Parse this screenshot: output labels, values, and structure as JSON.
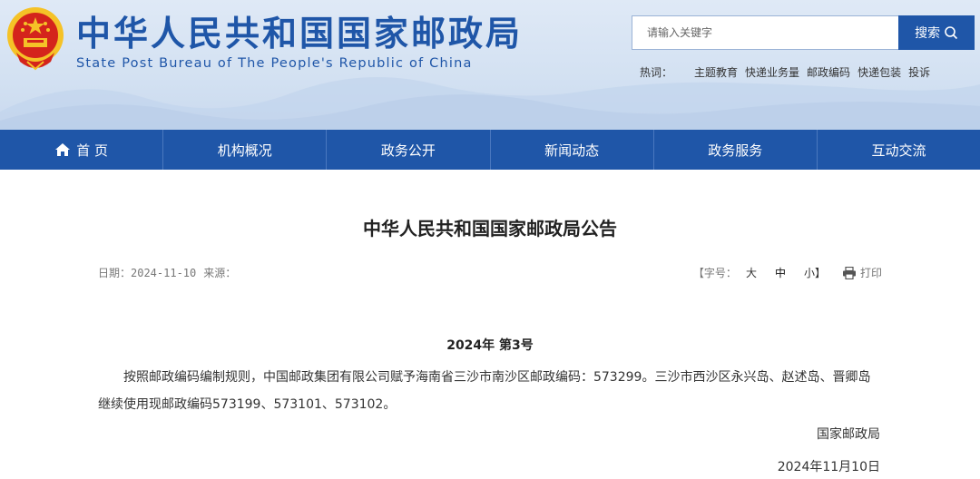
{
  "site": {
    "title_cn": "中华人民共和国国家邮政局",
    "title_en": "State Post Bureau of The People's Republic of China"
  },
  "search": {
    "placeholder": "请输入关键字",
    "button_label": "搜索"
  },
  "hot": {
    "label": "热词：",
    "items": [
      "主题教育",
      "快递业务量",
      "邮政编码",
      "快递包装",
      "投诉"
    ]
  },
  "nav": {
    "items": [
      "首 页",
      "机构概况",
      "政务公开",
      "新闻动态",
      "政务服务",
      "互动交流"
    ]
  },
  "article": {
    "title": "中华人民共和国国家邮政局公告",
    "date_label": "日期：2024-11-10",
    "source_label": "来源：",
    "font_size_label": "【字号：",
    "font_large": "大",
    "font_medium": "中",
    "font_small": "小】",
    "print_label": "打印",
    "doc_number": "2024年  第3号",
    "body": "按照邮政编码编制规则，中国邮政集团有限公司赋予海南省三沙市南沙区邮政编码：573299。三沙市西沙区永兴岛、赵述岛、晋卿岛继续使用现邮政编码573199、573101、573102。",
    "signature": "国家邮政局",
    "sign_date": "2024年11月10日"
  },
  "colors": {
    "brand": "#1f56a8",
    "emblem_red": "#d4241c",
    "emblem_gold": "#f5c227"
  }
}
